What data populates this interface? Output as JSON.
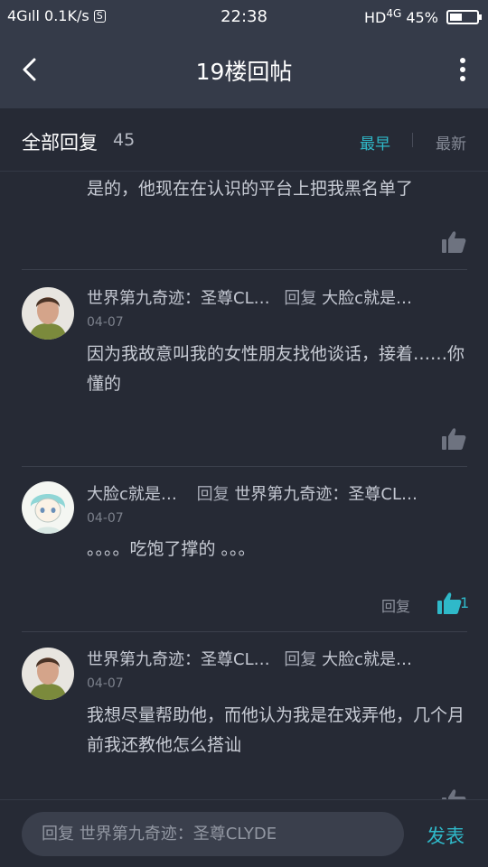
{
  "status_bar": {
    "network": "4G",
    "speed": "0.1K/s",
    "sim_badge": "S",
    "time": "22:38",
    "hd": "HD",
    "network_right": "4G",
    "battery": "45%"
  },
  "nav": {
    "title": "19楼回帖"
  },
  "filter": {
    "title": "全部回复",
    "count": "45",
    "sort_earliest": "最早",
    "sort_latest": "最新",
    "active_color": "#2fb9c9"
  },
  "comments": [
    {
      "text": "是的，他现在在认识的平台上把我黑名单了"
    },
    {
      "author": "世界第九奇迹：圣尊CL…",
      "reply_word": "回复",
      "reply_to": "大脸c就是…",
      "date": "04-07",
      "text": "因为我故意叫我的女性朋友找他谈话，接着……你懂的"
    },
    {
      "author": "大脸c就是…",
      "reply_word": "回复",
      "reply_to": "世界第九奇迹：圣尊CL…",
      "date": "04-07",
      "text": "。。。。吃饱了撑的 。。。",
      "reply_label": "回复",
      "likes": "1"
    },
    {
      "author": "世界第九奇迹：圣尊CL…",
      "reply_word": "回复",
      "reply_to": "大脸c就是…",
      "date": "04-07",
      "text": "我想尽量帮助他，而他认为我是在戏弄他，几个月前我还教他怎么搭讪"
    }
  ],
  "bottom": {
    "placeholder": "回复 世界第九奇迹：圣尊CLYDE",
    "send_label": "发表"
  }
}
